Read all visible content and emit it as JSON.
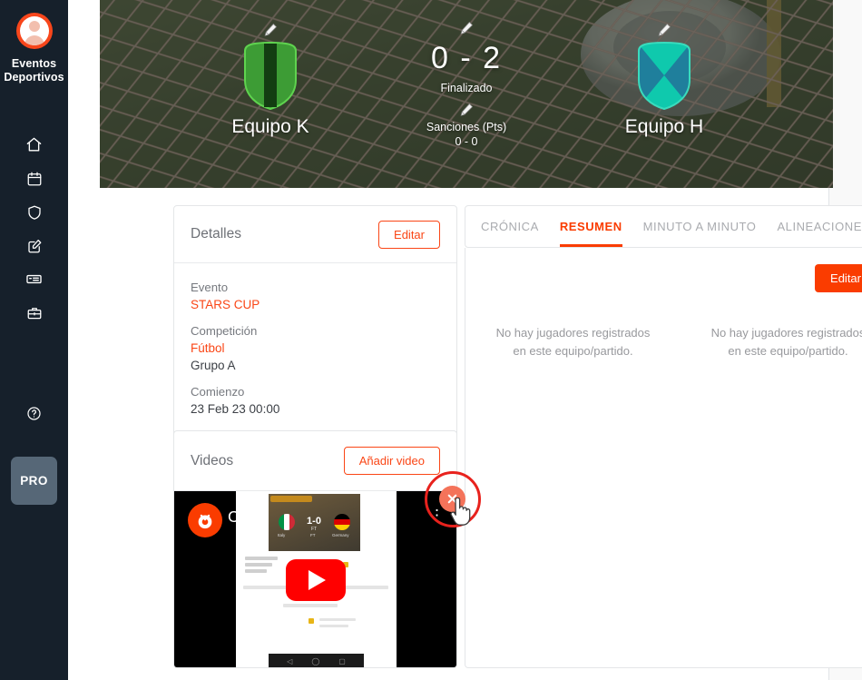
{
  "sidebar": {
    "brand_label": "Eventos\nDeportivos",
    "brand_line1": "Eventos",
    "brand_line2": "Deportivos",
    "avatar_icon": "user-avatar-icon",
    "items": [
      {
        "icon": "home-icon",
        "name": "home"
      },
      {
        "icon": "calendar-icon",
        "name": "calendar"
      },
      {
        "icon": "shield-icon",
        "name": "teams"
      },
      {
        "icon": "edit-square-icon",
        "name": "edit"
      },
      {
        "icon": "id-card-icon",
        "name": "licenses"
      },
      {
        "icon": "briefcase-icon",
        "name": "organization"
      }
    ],
    "help_icon": "help-circle-icon",
    "pro_label": "PRO"
  },
  "banner": {
    "home_team": {
      "name": "Equipo K",
      "edit_icon": "pencil-icon",
      "shield_color": "#3d9c35",
      "shield_stripe_color": "#133d12",
      "shield_border_color": "#5fd34f"
    },
    "away_team": {
      "name": "Equipo H",
      "edit_icon": "pencil-icon",
      "shield_color": "#0fc9ad",
      "shield_cross_color": "#1f7f9c",
      "shield_border_color": "#3adbbd"
    },
    "score": "0 - 2",
    "score_edit_icon": "pencil-icon",
    "status": "Finalizado",
    "sanctions_edit_icon": "pencil-icon",
    "sanctions_label": "Sanciones (Pts)",
    "sanctions_value": "0 - 0"
  },
  "details_card": {
    "title": "Detalles",
    "edit_label": "Editar",
    "fields": [
      {
        "label": "Evento",
        "value": "STARS CUP",
        "link": true
      },
      {
        "label": "Competición",
        "value": "Fútbol",
        "link": true,
        "sub": "Grupo A"
      },
      {
        "label": "Comienzo",
        "value": "23 Feb 23 00:00",
        "link": false
      }
    ],
    "evento_label": "Evento",
    "evento_value": "STARS CUP",
    "competicion_label": "Competición",
    "competicion_value": "Fútbol",
    "competicion_group": "Grupo A",
    "comienzo_label": "Comienzo",
    "comienzo_value": "23 Feb 23 00:00"
  },
  "videos_card": {
    "title": "Videos",
    "add_label": "Añadir video",
    "delete_icon": "close-circle-icon",
    "video": {
      "logo_icon": "competize-logo-icon",
      "title": "Competize for referees",
      "menu_icon": "kebab-menu-icon",
      "play_icon": "youtube-play-icon",
      "thumb_score": "1-0",
      "thumb_score_sub": "FT",
      "thumb_team_home": "Italy",
      "thumb_team_away": "Germany"
    }
  },
  "tabs_panel": {
    "tabs": [
      {
        "label": "CRÓNICA",
        "active": false
      },
      {
        "label": "RESUMEN",
        "active": true
      },
      {
        "label": "MINUTO A MINUTO",
        "active": false
      },
      {
        "label": "ALINEACIONES",
        "active": false
      }
    ],
    "edit_label": "Editar",
    "empty_left_line1": "No hay jugadores registrados",
    "empty_left_line2": "en este equipo/partido.",
    "empty_right_line1": "No hay jugadores registrados",
    "empty_right_line2": "en este equipo/partido."
  },
  "colors": {
    "accent": "#fa3c00",
    "accent_outline": "#fa4616",
    "sidebar_bg": "#16202b",
    "pro_bg": "#566777",
    "annotation_ring": "#e8221d",
    "delete_btn": "#f4735a"
  }
}
